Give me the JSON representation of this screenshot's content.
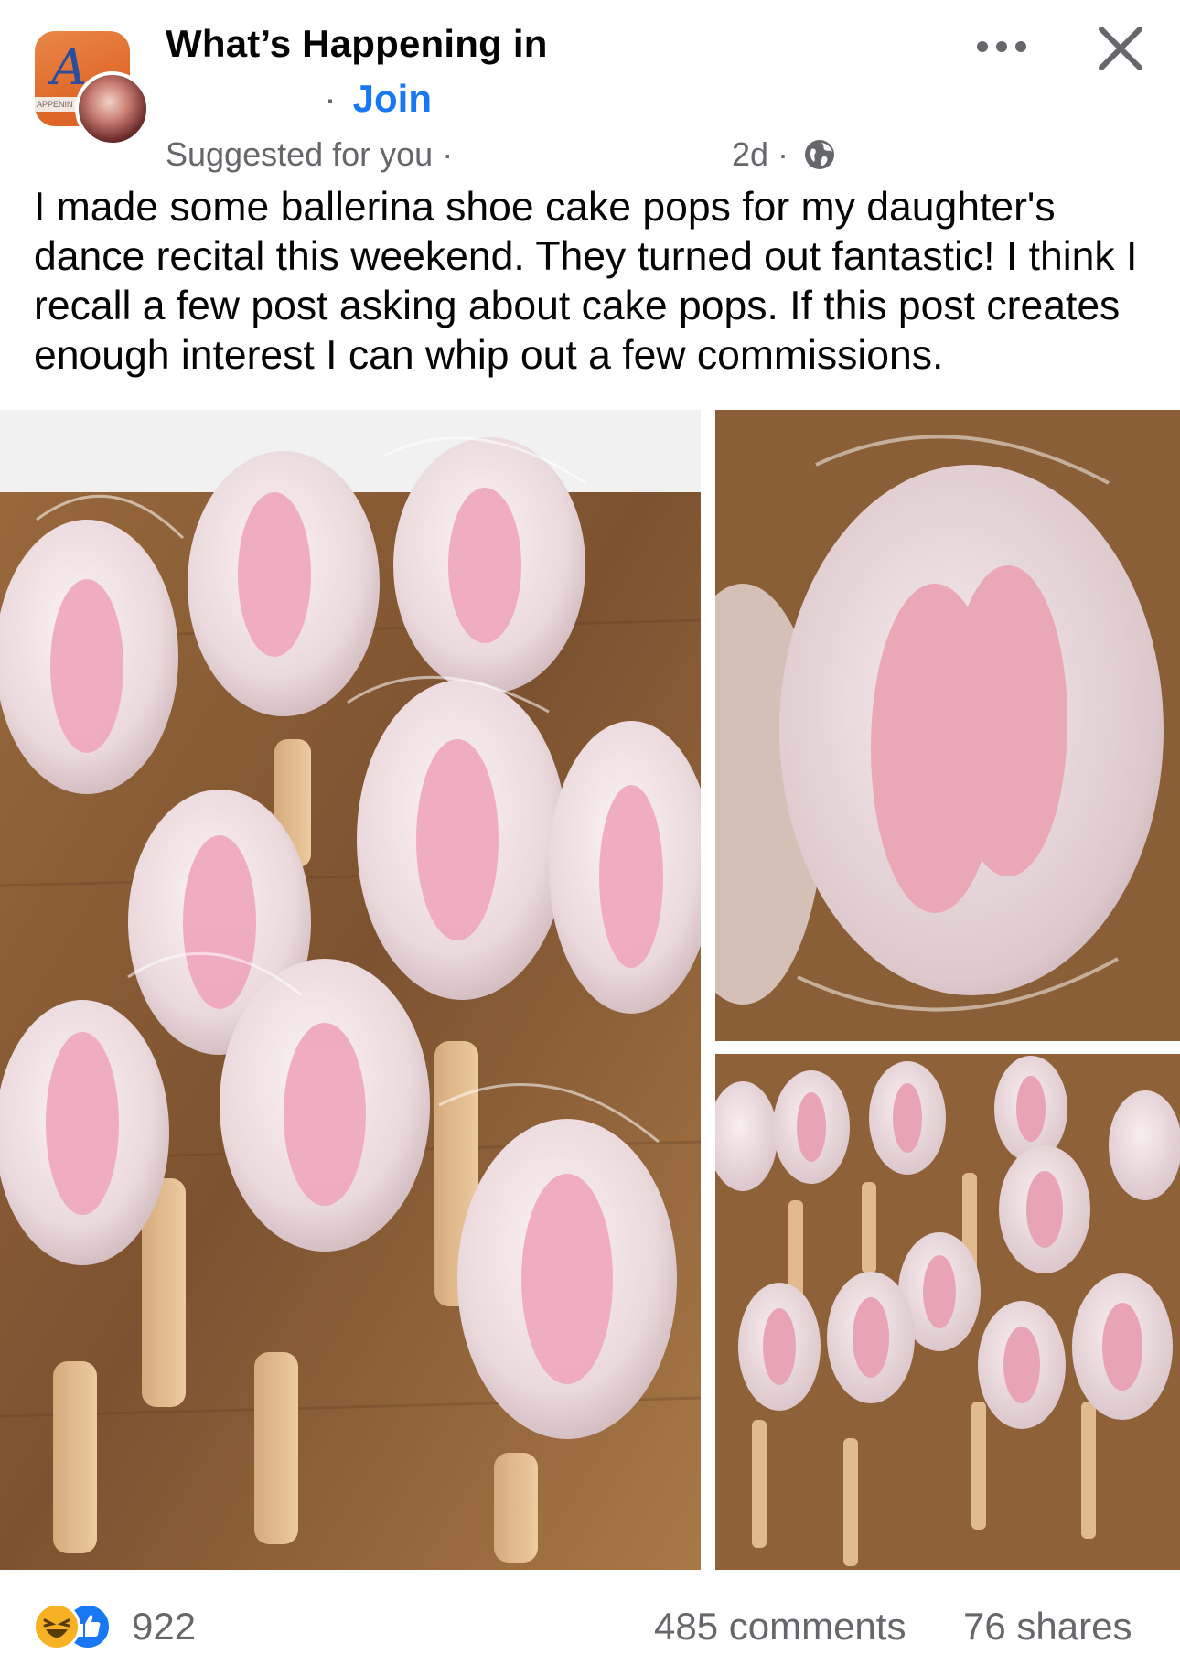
{
  "header": {
    "group_name": "What’s Happening in",
    "group_avatar_text": "A",
    "group_avatar_strip": "APPENIN",
    "join_separator": "·",
    "join_label": "Join",
    "suggested_label": "Suggested for you ·",
    "time_label": "2d ·",
    "icons": {
      "more": "more-options-icon",
      "close": "close-icon",
      "globe": "globe-public-icon"
    }
  },
  "post": {
    "text": "I made some ballerina shoe cake pops for my daughter's dance recital this weekend. They turned out fantastic! I think I recall a few post asking about cake pops. If this post creates enough interest I can whip out a few commissions."
  },
  "footer": {
    "reaction_count": "922",
    "comments_label": "485 comments",
    "shares_label": "76 shares",
    "reaction_icons": [
      "haha-icon",
      "like-icon"
    ]
  },
  "colors": {
    "link": "#1877f2",
    "secondary_text": "#65676b",
    "group_avatar": "#e06a2a",
    "like_blue": "#1877f2",
    "haha_yellow": "#f7b125"
  }
}
